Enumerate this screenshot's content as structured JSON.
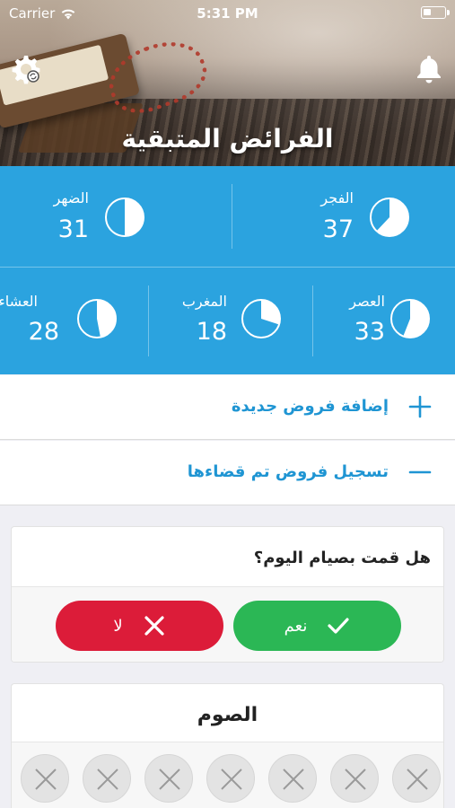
{
  "status_bar": {
    "carrier": "Carrier",
    "time": "5:31 PM"
  },
  "header": {
    "title": "الفرائض المتبقية"
  },
  "prayers": [
    {
      "name": "الفجر",
      "count": "37",
      "filled_fraction": 0.62
    },
    {
      "name": "الضهر",
      "count": "31",
      "filled_fraction": 0.5
    },
    {
      "name": "العصر",
      "count": "33",
      "filled_fraction": 0.56
    },
    {
      "name": "المغرب",
      "count": "18",
      "filled_fraction": 0.3
    },
    {
      "name": "العشاء",
      "count": "28",
      "filled_fraction": 0.47
    }
  ],
  "actions": {
    "add_label": "إضافة فروض جديدة",
    "record_label": "تسجيل فروض تم قضاءها"
  },
  "fasting_question": {
    "question": "هل قمت بصيام اليوم؟",
    "yes_label": "نعم",
    "no_label": "لا"
  },
  "fasting": {
    "title": "الصوم"
  },
  "colors": {
    "accent": "#2ba3df",
    "link": "#1f95d3",
    "yes": "#2bb755",
    "no": "#dc1c39"
  }
}
